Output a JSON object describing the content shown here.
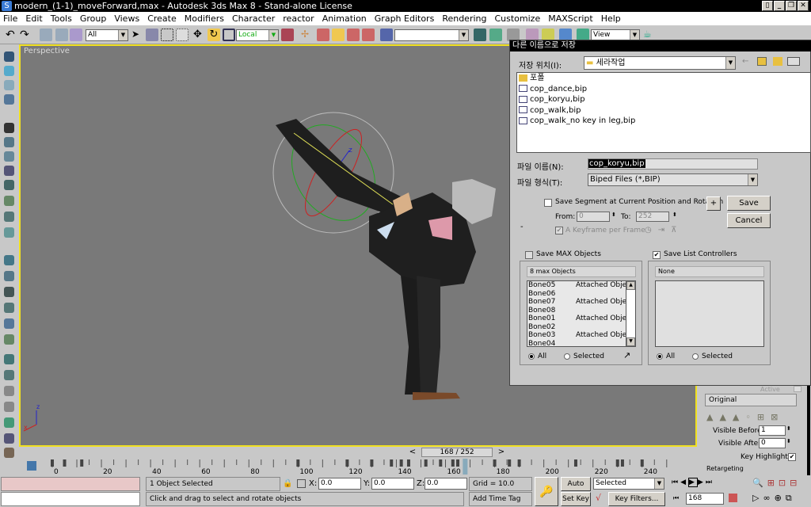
{
  "window": {
    "title": "modern_(1-1)_moveForward,max - Autodesk 3ds Max 8  - Stand-alone License",
    "controls": [
      "restore-viewport",
      "minimize",
      "maximize",
      "close"
    ]
  },
  "menu": [
    "File",
    "Edit",
    "Tools",
    "Group",
    "Views",
    "Create",
    "Modifiers",
    "Character",
    "reactor",
    "Animation",
    "Graph Editors",
    "Rendering",
    "Customize",
    "MAXScript",
    "Help"
  ],
  "toolbar": {
    "selection_filter": "All",
    "coord_system": "Local",
    "named_selection": "",
    "render_type": "View",
    "accent_active": "#f0c850"
  },
  "viewport": {
    "label": "Perspective",
    "border_color": "#f0e020",
    "gizmo_axis": "z"
  },
  "timeslider": {
    "current": 168,
    "total": 252,
    "label": "168 / 252",
    "prev": "<",
    "next": ">"
  },
  "trackbar": {
    "ticks": [
      "0",
      "20",
      "40",
      "60",
      "80",
      "100",
      "120",
      "140",
      "160",
      "180",
      "200",
      "220",
      "240"
    ],
    "keys": [
      0,
      5,
      12,
      100,
      120,
      130,
      138,
      142,
      145,
      152,
      158,
      163,
      165,
      168,
      180,
      186,
      190,
      213,
      230,
      232,
      240
    ]
  },
  "status": {
    "selection": "1 Object Selected",
    "prompt": "Click and drag to select and rotate objects",
    "x": "0.0",
    "y": "0.0",
    "z": "0.0",
    "x_label": "X:",
    "y_label": "Y:",
    "z_label": "Z:",
    "grid": "Grid = 10.0",
    "add_time_tag": "Add Time Tag",
    "auto_key": "Auto Key",
    "set_key": "Set Key",
    "key_mode": "Selected",
    "key_filters": "Key Filters...",
    "frame": "168"
  },
  "dialog": {
    "title": "다른 이름으로 저장",
    "save_in_label": "저장 위치(I):",
    "save_in_value": "세라작업",
    "files": [
      {
        "name": "포폴",
        "type": "folder"
      },
      {
        "name": "cop_dance,bip",
        "type": "file"
      },
      {
        "name": "cop_koryu,bip",
        "type": "file"
      },
      {
        "name": "cop_walk,bip",
        "type": "file"
      },
      {
        "name": "cop_walk_no key in leg,bip",
        "type": "file"
      }
    ],
    "filename_label": "파일 이름(N):",
    "filename_value": "cop_koryu,bip",
    "filetype_label": "파일 형식(T):",
    "filetype_value": "Biped Files (*,BIP)",
    "save_segment": {
      "label": "Save Segment at Current Position and Rotation",
      "checked": false
    },
    "plus": "+",
    "save": "Save",
    "cancel": "Cancel",
    "from_label": "From:",
    "from_value": "0",
    "to_label": "To:",
    "to_value": "252",
    "keyframe_per_frame": {
      "label": "A Keyframe per Frame",
      "checked": true
    },
    "dash": "-",
    "save_max_objects": {
      "label": "Save MAX Objects",
      "checked": false,
      "header": "8 max Objects",
      "rows": [
        {
          "name": "Bone05",
          "status": "Attached Objec"
        },
        {
          "name": "Bone06",
          "status": ""
        },
        {
          "name": "Bone07",
          "status": "Attached Objec"
        },
        {
          "name": "Bone08",
          "status": ""
        },
        {
          "name": "Bone01",
          "status": "Attached Objec"
        },
        {
          "name": "Bone02",
          "status": ""
        },
        {
          "name": "Bone03",
          "status": "Attached Objec"
        },
        {
          "name": "Bone04",
          "status": ""
        }
      ],
      "all": "All",
      "selected": "Selected",
      "mode": "All"
    },
    "save_list_controllers": {
      "label": "Save List Controllers",
      "checked": true,
      "header": "None",
      "all": "All",
      "selected": "Selected",
      "mode": "All"
    }
  },
  "command_panel": {
    "active_label": "Active",
    "layer_name": "Original",
    "visible_before_label": "Visible Before:",
    "visible_before": "1",
    "visible_after_label": "Visible After:",
    "visible_after": "0",
    "key_highlight_label": "Key Highlight",
    "key_highlight": true,
    "retargeting": "Retargeting"
  }
}
